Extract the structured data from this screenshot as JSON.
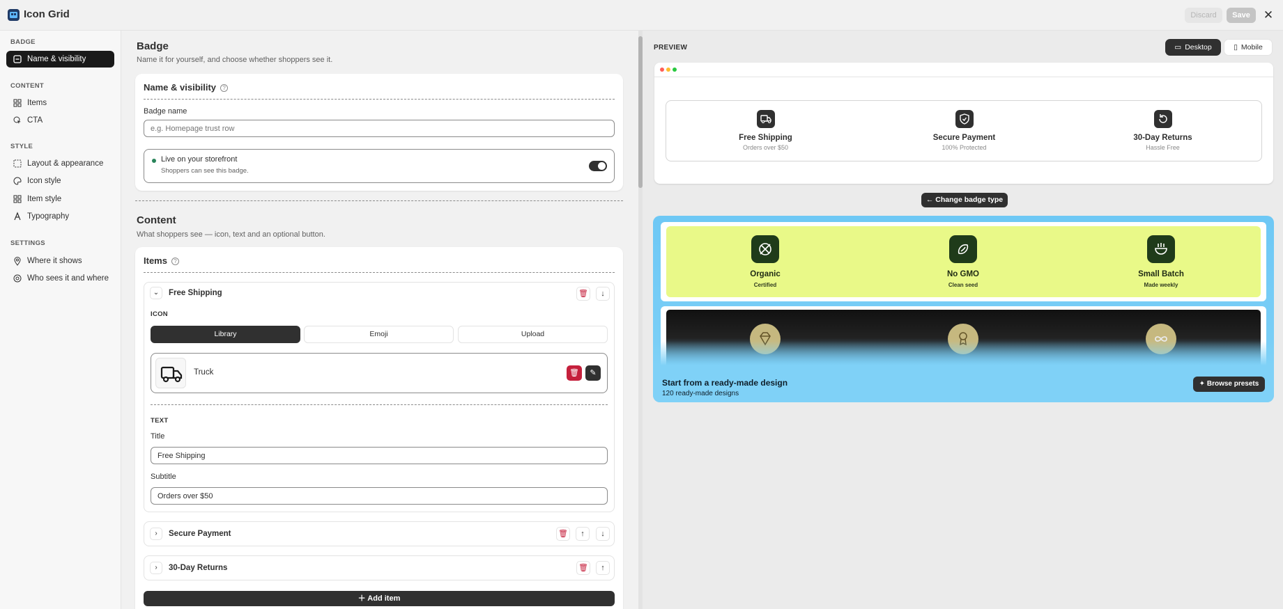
{
  "app": {
    "title": "Icon Grid",
    "discard_label": "Discard",
    "save_label": "Save"
  },
  "sidebar": {
    "sections": [
      {
        "label": "BADGE",
        "items": [
          {
            "label": "Name & visibility",
            "icon": "badge-icon",
            "active": true
          }
        ]
      },
      {
        "label": "CONTENT",
        "items": [
          {
            "label": "Items",
            "icon": "grid-icon"
          },
          {
            "label": "CTA",
            "icon": "cursor-icon"
          }
        ]
      },
      {
        "label": "STYLE",
        "items": [
          {
            "label": "Layout & appearance",
            "icon": "layout-icon"
          },
          {
            "label": "Icon style",
            "icon": "palette-icon"
          },
          {
            "label": "Item style",
            "icon": "grid-icon"
          },
          {
            "label": "Typography",
            "icon": "text-icon"
          }
        ]
      },
      {
        "label": "SETTINGS",
        "items": [
          {
            "label": "Where it shows",
            "icon": "location-icon"
          },
          {
            "label": "Who sees it and where",
            "icon": "target-icon"
          }
        ]
      }
    ]
  },
  "badge_section": {
    "title": "Badge",
    "subtitle": "Name it for yourself, and choose whether shoppers see it.",
    "card_title": "Name & visibility",
    "name_label": "Badge name",
    "name_placeholder": "e.g. Homepage trust row",
    "live_title": "Live on your storefront",
    "live_sub": "Shoppers can see this badge."
  },
  "content_section": {
    "title": "Content",
    "subtitle": "What shoppers see — icon, text and an optional button.",
    "card_title": "Items",
    "items": [
      {
        "title": "Free Shipping"
      },
      {
        "title": "Secure Payment"
      },
      {
        "title": "30-Day Returns"
      }
    ],
    "icon_label": "ICON",
    "tabs": [
      "Library",
      "Emoji",
      "Upload"
    ],
    "selected_icon": "Truck",
    "text_label": "TEXT",
    "title_label": "Title",
    "title_value": "Free Shipping",
    "subtitle_label": "Subtitle",
    "subtitle_value": "Orders over $50",
    "add_item": "Add item"
  },
  "preview": {
    "label": "PREVIEW",
    "desktop": "Desktop",
    "mobile": "Mobile",
    "badges": [
      {
        "title": "Free Shipping",
        "sub": "Orders over $50",
        "icon": "truck-icon"
      },
      {
        "title": "Secure Payment",
        "sub": "100% Protected",
        "icon": "shield-icon"
      },
      {
        "title": "30-Day Returns",
        "sub": "Hassle Free",
        "icon": "return-icon"
      }
    ],
    "change_badge": "Change badge type",
    "preset_items": [
      {
        "title": "Organic",
        "sub": "Certified",
        "icon": "leaf-icon"
      },
      {
        "title": "No GMO",
        "sub": "Clean seed",
        "icon": "bean-icon"
      },
      {
        "title": "Small Batch",
        "sub": "Made weekly",
        "icon": "bowl-icon"
      }
    ],
    "start_title": "Start from a ready-made design",
    "start_sub": "120 ready-made designs",
    "browse": "Browse presets"
  }
}
